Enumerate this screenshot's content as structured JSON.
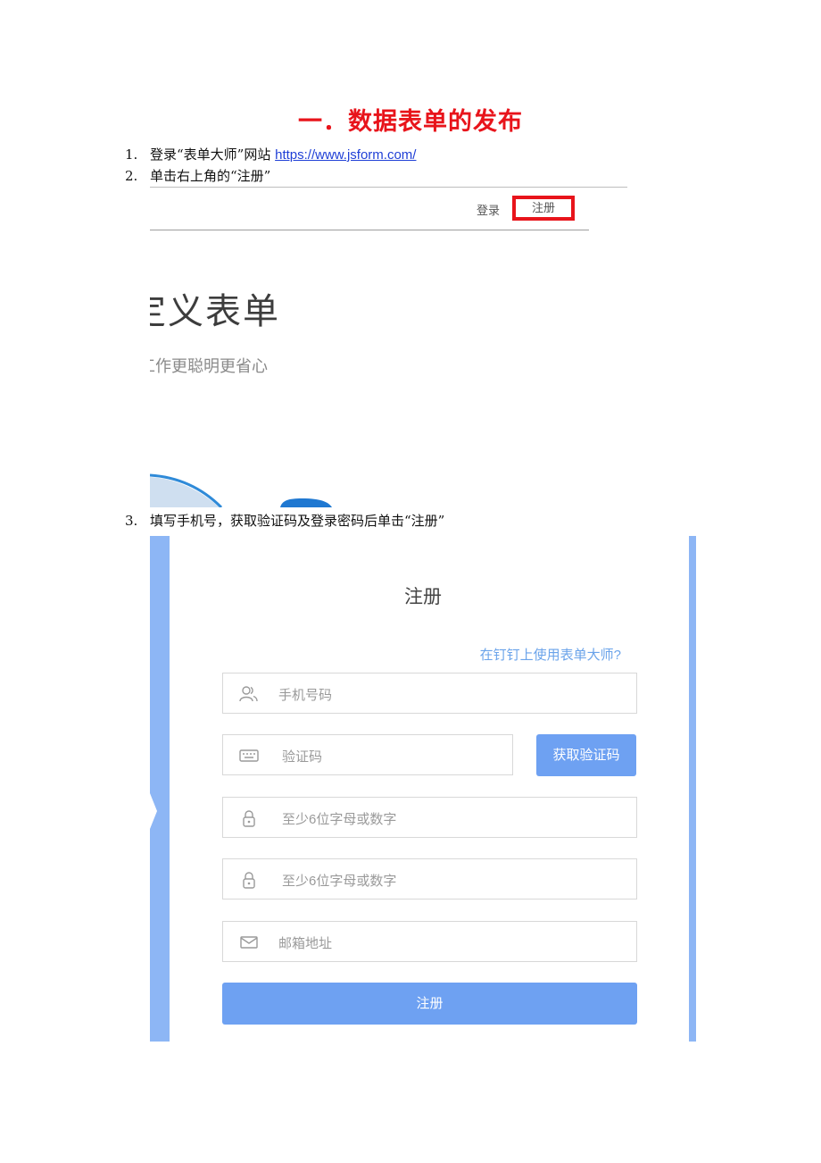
{
  "document": {
    "title": "一．数据表单的发布",
    "steps": [
      {
        "num": "1.",
        "text": "登录“表单大师”网站 ",
        "link": "https://www.jsform.com/"
      },
      {
        "num": "2.",
        "text": "单击右上角的“注册”"
      },
      {
        "num": "3.",
        "text": "填写手机号，获取验证码及登录密码后单击“注册”"
      }
    ]
  },
  "homepage_screenshot": {
    "login_label": "登录",
    "register_label": "注册",
    "hero_title": "定义表单",
    "hero_subtitle": "工作更聪明更省心",
    "highlight_color": "#e8141b"
  },
  "register_form": {
    "title": "注册",
    "dingtalk_link": "在钉钉上使用表单大师?",
    "phone_placeholder": "手机号码",
    "code_placeholder": "验证码",
    "get_code_label": "获取验证码",
    "password_placeholder": "至少6位字母或数字",
    "confirm_password_placeholder": "至少6位字母或数字",
    "email_placeholder": "邮箱地址",
    "submit_label": "注册",
    "accent_color": "#6ea1f2"
  }
}
